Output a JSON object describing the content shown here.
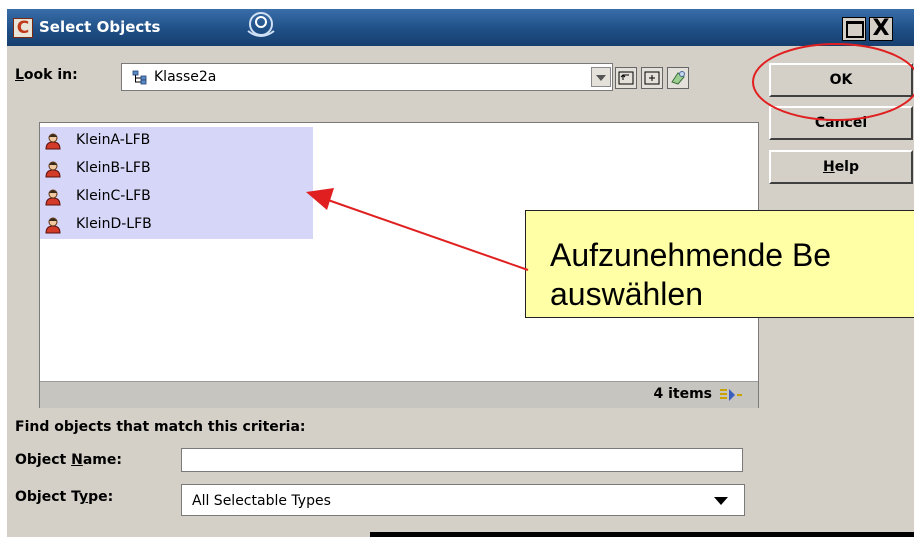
{
  "window": {
    "title": "Select Objects",
    "app_icon_letter": "C",
    "close_symbol": "X"
  },
  "look_in": {
    "label_underlined": "L",
    "label_rest": "ook in:",
    "value": "Klasse2a"
  },
  "buttons": {
    "ok": "OK",
    "cancel": "Cancel",
    "help_underlined": "H",
    "help_rest": "elp"
  },
  "list": {
    "items": [
      "KleinA-LFB",
      "KleinB-LFB",
      "KleinC-LFB",
      "KleinD-LFB"
    ],
    "status": "4 items"
  },
  "criteria": {
    "heading": "Find objects that match this criteria:",
    "name_label_pre": "Object ",
    "name_label_underlined": "N",
    "name_label_post": "ame:",
    "name_value": "",
    "type_label_pre": "Object T",
    "type_label_underlined": "y",
    "type_label_post": "pe:",
    "type_value": "All Selectable Types"
  },
  "annotation": {
    "callout_text": "Aufzunehmende Be\nauswählen"
  },
  "colors": {
    "titlebar": "#1f4f86",
    "dialog_bg": "#d4d0c8",
    "selection": "#d6d6f8",
    "callout_bg": "#ffffa6",
    "annotation_red": "#e02020"
  }
}
